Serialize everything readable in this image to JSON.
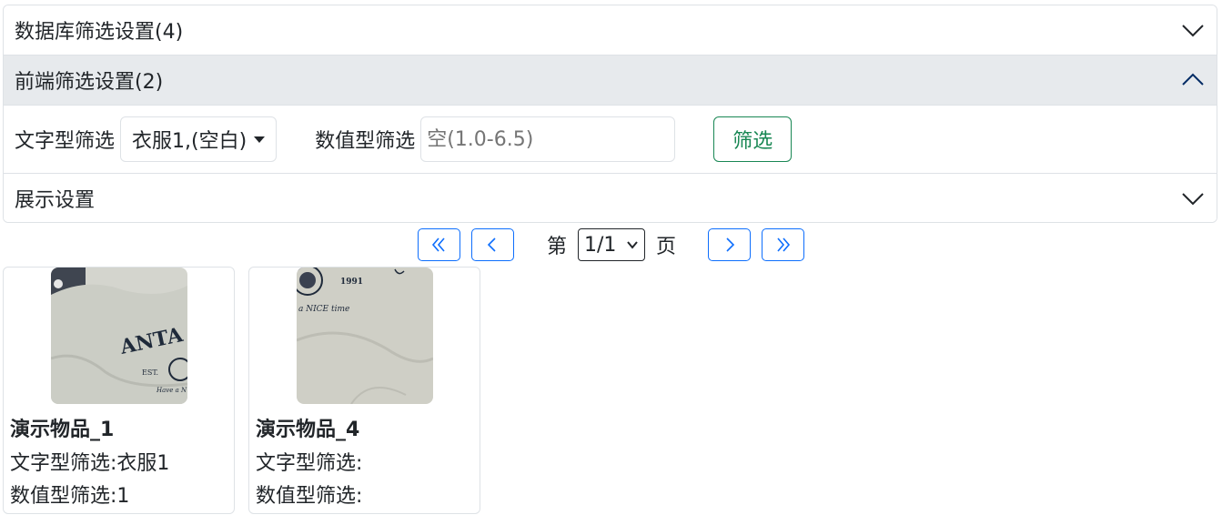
{
  "accordion": {
    "db_filter_title": "数据库筛选设置(4)",
    "front_filter_title": "前端筛选设置(2)",
    "display_title": "展示设置",
    "text_filter_label": "文字型筛选",
    "text_filter_value": "衣服1,(空白)",
    "num_filter_label": "数值型筛选",
    "num_filter_placeholder": "空(1.0-6.5)",
    "filter_button": "筛选"
  },
  "pager": {
    "prefix": "第",
    "current": "1/1",
    "suffix": "页"
  },
  "items": [
    {
      "name": "演示物品_1",
      "text_line": "文字型筛选:衣服1",
      "num_line": "数值型筛选:1",
      "image_text_1": "ANTA SPO",
      "image_text_2": "EST.",
      "image_text_3": "Have a N"
    },
    {
      "name": "演示物品_4",
      "text_line": "文字型筛选:",
      "num_line": "数值型筛选:",
      "image_text_1": "1991",
      "image_text_2": "a NICE time"
    }
  ],
  "colors": {
    "primary": "#0d6efd",
    "success": "#198754",
    "header_open_bg": "#e7eaed",
    "border": "#dee2e6"
  }
}
